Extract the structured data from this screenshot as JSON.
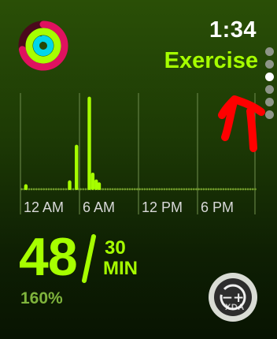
{
  "watch": {
    "time": "1:34",
    "screen_title": "Exercise",
    "page_indicator": {
      "count": 6,
      "active_index": 2
    }
  },
  "activity_ring": {
    "name": "activity-rings-icon",
    "colors": [
      "#e0115f",
      "#a6ff00",
      "#00d6e8"
    ],
    "move_progress": 0.72,
    "exercise_progress": 1.0,
    "stand_progress": 0.92
  },
  "chart_data": {
    "type": "bar",
    "x_ticks": [
      "12 AM",
      "6 AM",
      "12 PM",
      "6 PM"
    ],
    "bar_color": "#a6ff00",
    "baseline_dot_color": "#6f9a2a",
    "bars": [
      {
        "x": 0.55,
        "value": 0.06
      },
      {
        "x": 5.0,
        "value": 0.1
      },
      {
        "x": 5.7,
        "value": 0.47
      },
      {
        "x": 7.0,
        "value": 0.97
      },
      {
        "x": 7.35,
        "value": 0.18
      },
      {
        "x": 7.7,
        "value": 0.11
      },
      {
        "x": 8.0,
        "value": 0.08
      }
    ]
  },
  "summary": {
    "exercise_minutes": "48",
    "goal_value": "30",
    "goal_unit": "MIN",
    "percent": "160%"
  },
  "button": {
    "name": "timer-adjust-icon"
  },
  "annotation": {
    "arrow_color": "#ff0000"
  },
  "watermark": "XDA"
}
